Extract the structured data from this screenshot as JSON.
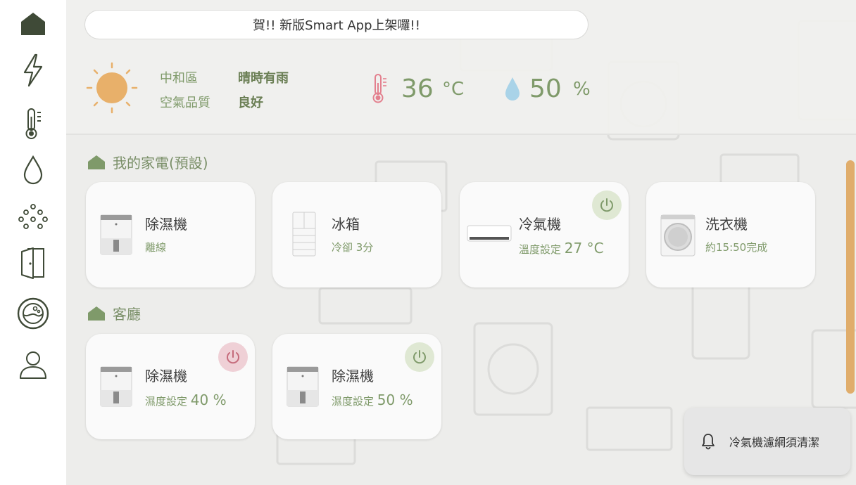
{
  "announcement": "賀!! 新版Smart App上架囉!!",
  "weather": {
    "district": "中和區",
    "condition": "晴時有雨",
    "air_quality_label": "空氣品質",
    "air_quality_value": "良好",
    "temperature": "36",
    "temperature_unit": "°C",
    "humidity": "50",
    "humidity_unit": "%"
  },
  "sidebar": {
    "items": [
      "home-icon",
      "lightning-icon",
      "thermometer-icon",
      "water-drop-icon",
      "dots-grid-icon",
      "door-icon",
      "washer-icon",
      "user-icon"
    ]
  },
  "sections": [
    {
      "title": "我的家電(預設)",
      "devices": [
        {
          "name": "除濕機",
          "status": "離線"
        },
        {
          "name": "冰箱",
          "status": "冷卻 3分"
        },
        {
          "name": "冷氣機",
          "status_prefix": "溫度設定",
          "status_value": "27 °C"
        },
        {
          "name": "洗衣機",
          "status": "約15:50完成"
        }
      ]
    },
    {
      "title": "客廳",
      "devices": [
        {
          "name": "除濕機",
          "status_prefix": "濕度設定",
          "status_value": "40 %"
        },
        {
          "name": "除濕機",
          "status_prefix": "濕度設定",
          "status_value": "50 %"
        }
      ]
    }
  ],
  "notification": "冷氣機濾網須清潔",
  "colors": {
    "accent_green": "#7f9a6a",
    "sidebar_icon": "#3f4a37",
    "power_on": "#dfe8d3",
    "power_off": "#efd0d6",
    "scrollbar": "#e0ad6b",
    "sun": "#e8b06a",
    "humidity_drop": "#a9d3e8",
    "thermo_red": "#e3808e"
  }
}
